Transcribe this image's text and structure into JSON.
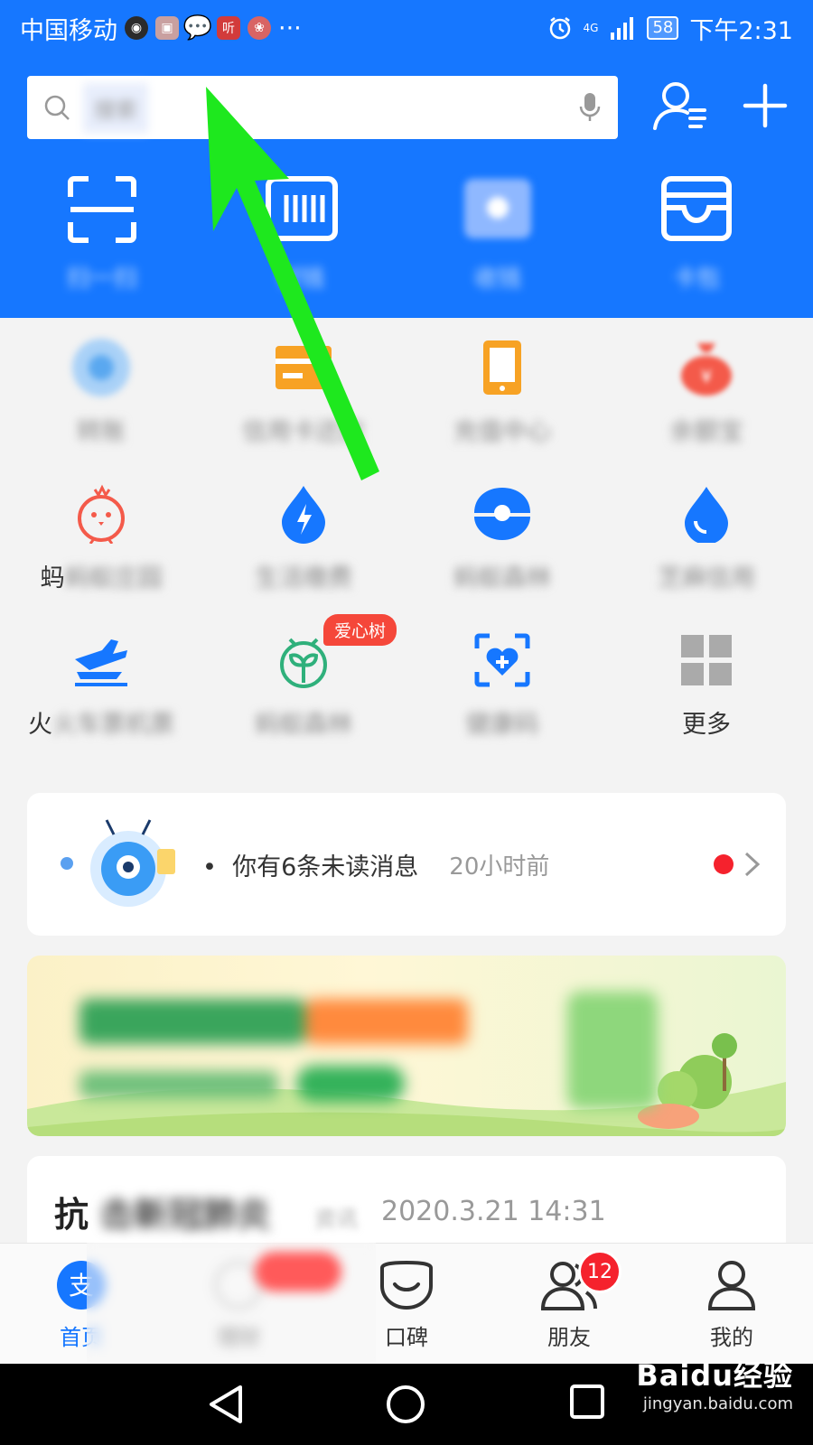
{
  "status_bar": {
    "carrier": "中国移动",
    "app_icons": [
      "移动视频",
      "搜索",
      "消息",
      "听",
      "视频"
    ],
    "more": "···",
    "network": "4G",
    "battery": "58",
    "time": "下午2:31"
  },
  "search": {
    "placeholder": "搜索"
  },
  "top_actions": [
    {
      "id": "scan",
      "label": "扫一扫",
      "icon": "scan-icon"
    },
    {
      "id": "pay",
      "label": "付钱",
      "icon": "barcode-icon"
    },
    {
      "id": "collect",
      "label": "收钱",
      "icon": "collect-icon"
    },
    {
      "id": "cards",
      "label": "卡包",
      "icon": "wallet-card-icon"
    }
  ],
  "grid": [
    {
      "id": "alipay-icon",
      "label": "转账",
      "blurred": true
    },
    {
      "id": "credit-card-icon",
      "label": "信用卡还款",
      "blurred": true
    },
    {
      "id": "phone-icon",
      "label": "充值中心",
      "blurred": true
    },
    {
      "id": "moneybag-icon",
      "label": "余额宝",
      "blurred": true
    },
    {
      "id": "chick-icon",
      "label": "蚂蚁庄园",
      "prefix": "蚂",
      "blurred": true
    },
    {
      "id": "lightning-drop-icon",
      "label": "生活缴费",
      "blurred": true
    },
    {
      "id": "pearl-icon",
      "label": "蚂蚁森林",
      "blurred": true
    },
    {
      "id": "drop-icon",
      "label": "芝麻信用",
      "suffix": "用",
      "blurred": true
    },
    {
      "id": "train-plane-icon",
      "label": "火车票机票",
      "prefix": "火",
      "blurred": true
    },
    {
      "id": "sprout-icon",
      "label": "蚂蚁森林",
      "blurred": true
    },
    {
      "id": "health-icon",
      "label": "健康码",
      "blurred": true
    },
    {
      "id": "more-grid-icon",
      "label": "更多",
      "blurred": false
    }
  ],
  "love_badge": "爱心树",
  "message": {
    "text": "你有6条未读消息",
    "time": "20小时前"
  },
  "banner": {},
  "news": {
    "head": "抗",
    "rest": "击新冠肺炎",
    "tag": "资讯",
    "time": "2020.3.21 14:31"
  },
  "tabs": [
    {
      "id": "home",
      "label": "首页",
      "active": true
    },
    {
      "id": "wealth",
      "label": "理财",
      "active": false
    },
    {
      "id": "koubei",
      "label": "口碑",
      "active": false
    },
    {
      "id": "friends",
      "label": "朋友",
      "active": false
    },
    {
      "id": "mine",
      "label": "我的",
      "active": false
    }
  ],
  "friends_badge": "12",
  "watermark": {
    "main": "Baidu经验",
    "sub": "jingyan.baidu.com"
  },
  "colors": {
    "brand_blue": "#1677ff",
    "arrow_green": "#1ee81e",
    "badge_red": "#f5222d"
  }
}
